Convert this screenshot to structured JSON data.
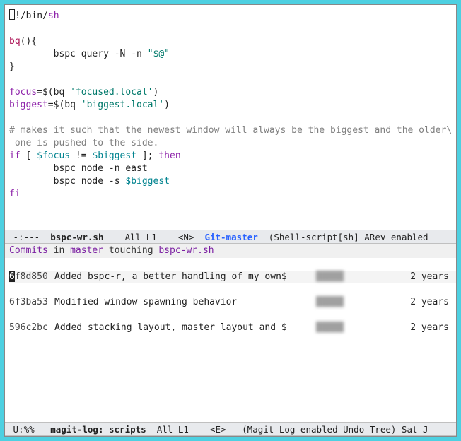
{
  "editor": {
    "shebang_prefix": "!/bin/",
    "shebang_shell": "sh",
    "funcdef_name": "bq",
    "funcdef_suffix": "(){",
    "line_query_indent": "        ",
    "line_query_cmd": "bspc query -N -n ",
    "line_query_str": "\"$@\"",
    "close_brace": "}",
    "assign1_lhs": "focus",
    "assign1_eq": "=$(",
    "assign1_fn": "bq ",
    "assign1_arg": "'focused.local'",
    "assign1_close": ")",
    "assign2_lhs": "biggest",
    "assign2_eq": "=$(",
    "assign2_fn": "bq ",
    "assign2_arg": "'biggest.local'",
    "assign2_close": ")",
    "comment1": "# makes it such that the newest window will always be the biggest and the older\\",
    "comment2": " one is pushed to the side.",
    "if_kw": "if",
    "if_bracket_open": " [ ",
    "if_var1": "$focus",
    "if_op": " != ",
    "if_var2": "$biggest",
    "if_bracket_close": " ]; ",
    "then_kw": "then",
    "body1": "        bspc node -n east",
    "body2_prefix": "        bspc node -s ",
    "body2_var": "$biggest",
    "fi_kw": "fi"
  },
  "modeline_top": {
    "left": " -:---  ",
    "filename": "bspc-wr.sh",
    "mid": "    All L1    <N>  ",
    "git": "Git-master",
    "right": "  (Shell-script[sh] ARev enabled"
  },
  "magit": {
    "header_kw1": "Commits",
    "header_txt1": " in ",
    "header_kw2": "master",
    "header_txt2": " touching ",
    "header_kw3": "bspc-wr.sh",
    "commits": [
      {
        "hash": "6f8d850",
        "msg": "Added bspc-r, a better handling of my own$",
        "author": "█████",
        "age": "2 years"
      },
      {
        "hash": "6f3ba53",
        "msg": "Modified window spawning behavior",
        "author": "█████",
        "age": "2 years"
      },
      {
        "hash": "596c2bc",
        "msg": "Added stacking layout, master layout and $",
        "author": "█████",
        "age": "2 years"
      }
    ]
  },
  "modeline_bottom": {
    "left": " U:%%-  ",
    "filename": "magit-log: scripts",
    "mid": "  All L1    <E>   (Magit Log enabled Undo-Tree) Sat J"
  }
}
